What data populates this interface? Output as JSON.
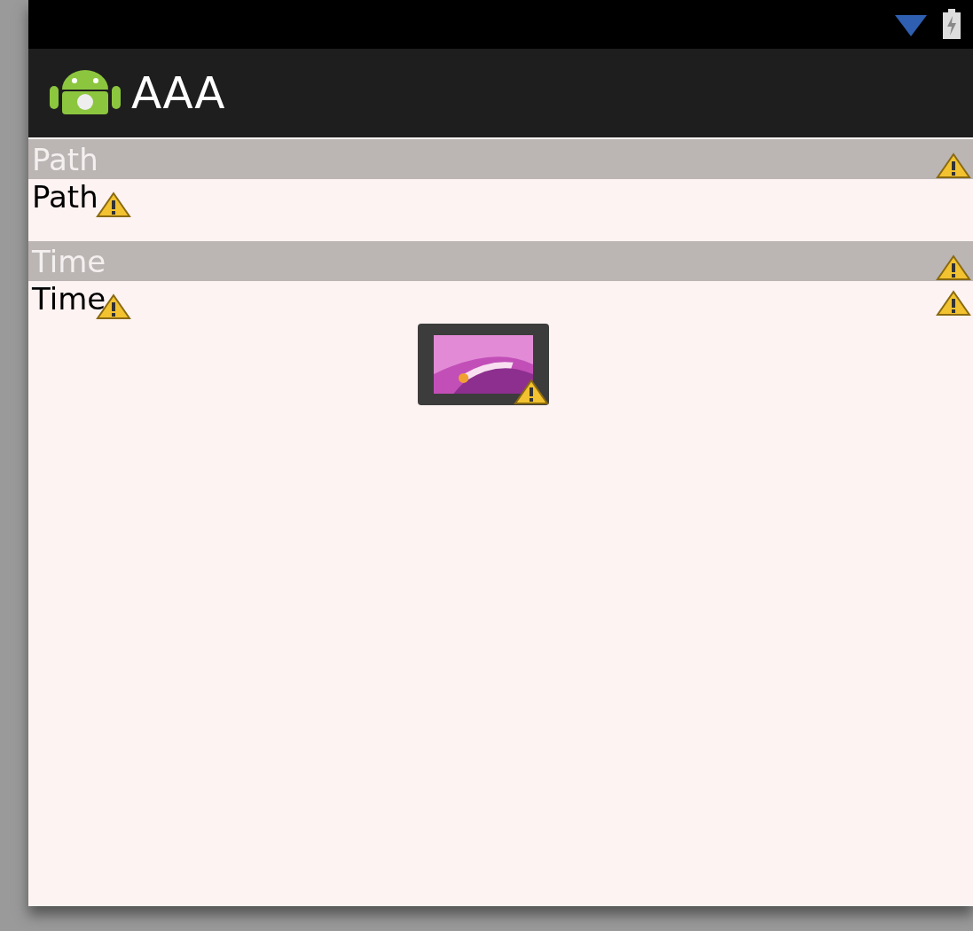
{
  "app_bar": {
    "title": "AAA"
  },
  "sections": [
    {
      "header": "Path",
      "value": "Path",
      "row_warning": false
    },
    {
      "header": "Time",
      "value": "Time",
      "row_warning": true
    }
  ]
}
